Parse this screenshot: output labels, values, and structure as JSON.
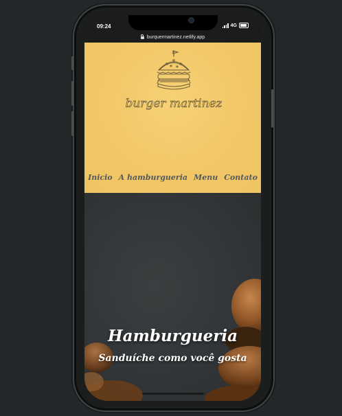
{
  "status_bar": {
    "time": "09:24",
    "network": "4G",
    "url": "burquermartinez.netlify.app"
  },
  "header": {
    "logo_icon": "burger-sketch-icon",
    "logo_text": "burger martinez",
    "nav": [
      {
        "label": "Inicio"
      },
      {
        "label": "A hamburgueria"
      },
      {
        "label": "Menu"
      },
      {
        "label": "Contato"
      }
    ]
  },
  "hero": {
    "title": "Hamburgueria",
    "subtitle": "Sanduíche como você gosta"
  },
  "colors": {
    "header_bg": "#f2c767",
    "nav_text": "#545a60",
    "hero_bg": "#323638",
    "page_bg": "#24272a"
  }
}
